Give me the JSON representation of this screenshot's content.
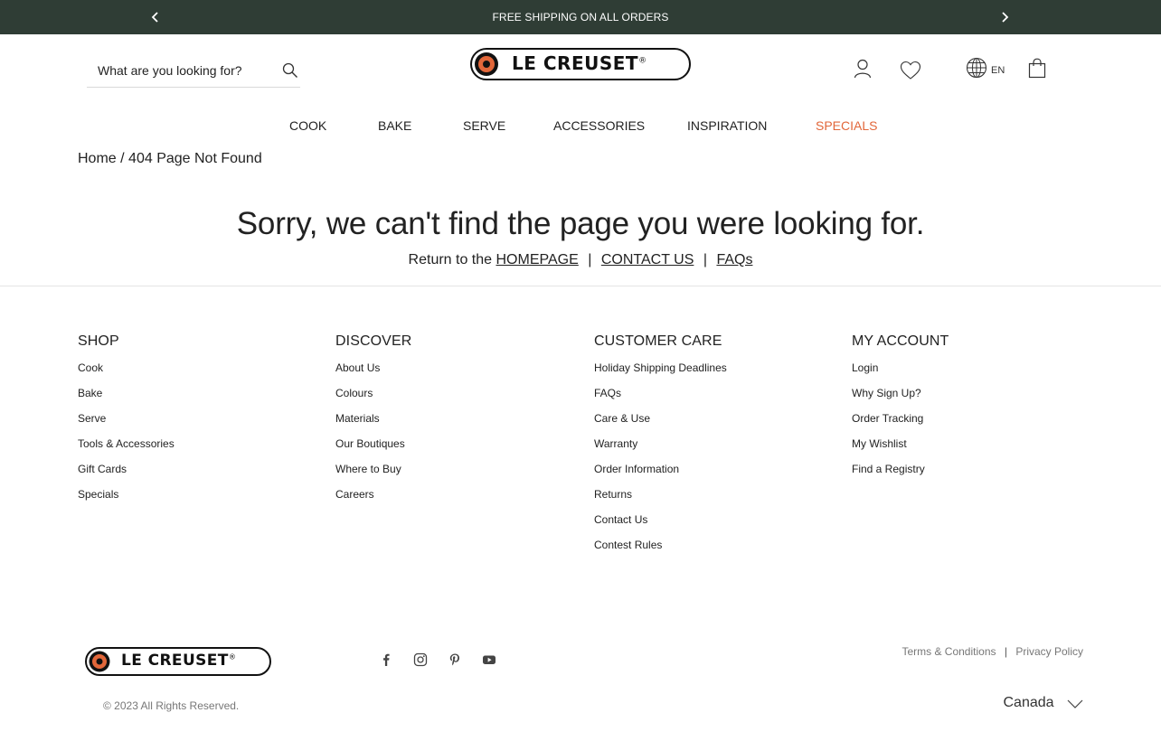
{
  "promo": {
    "text": "FREE SHIPPING ON ALL ORDERS",
    "prev_icon": "chevron-left-icon",
    "next_icon": "chevron-right-icon"
  },
  "header": {
    "search_placeholder": "What are you looking for?",
    "search_icon": "search-icon",
    "logo_text": "LE CREUSET",
    "logo_mark": "®",
    "account_icon": "user-icon",
    "wishlist_icon": "heart-icon",
    "language_icon": "globe-icon",
    "language": "EN",
    "cart_icon": "shopping-bag-icon"
  },
  "nav": {
    "items": [
      "COOK",
      "BAKE",
      "SERVE",
      "ACCESSORIES",
      "INSPIRATION",
      "SPECIALS"
    ],
    "specials_color": "#e2673a"
  },
  "breadcrumb": {
    "home": "Home",
    "separator": "/",
    "current": "404 Page Not Found"
  },
  "error": {
    "title": "Sorry, we can't find the page you were looking for.",
    "return_text": "Return to the",
    "homepage": "HOMEPAGE",
    "contact": "CONTACT US",
    "faqs": "FAQs",
    "separator": "|"
  },
  "footer": {
    "shop": {
      "title": "SHOP",
      "links": [
        "Cook",
        "Bake",
        "Serve",
        "Tools & Accessories",
        "Gift Cards",
        "Specials"
      ]
    },
    "discover": {
      "title": "DISCOVER",
      "links": [
        "About Us",
        "Colours",
        "Materials",
        "Our Boutiques",
        "Where to Buy",
        "Careers"
      ]
    },
    "customer_care": {
      "title": "CUSTOMER CARE",
      "links": [
        "Holiday Shipping Deadlines",
        "FAQs",
        "Care & Use",
        "Warranty",
        "Order Information",
        "Returns",
        "Contact Us",
        "Contest Rules"
      ]
    },
    "my_account": {
      "title": "MY ACCOUNT",
      "links": [
        "Login",
        "Why Sign Up?",
        "Order Tracking",
        "My Wishlist",
        "Find a Registry"
      ]
    },
    "social": [
      "facebook-icon",
      "instagram-icon",
      "pinterest-icon",
      "youtube-icon"
    ],
    "terms": "Terms & Conditions",
    "privacy": "Privacy Policy",
    "legal_separator": "|",
    "copyright": "© 2023 All Rights Reserved.",
    "region": "Canada",
    "region_icon": "chevron-down-icon"
  },
  "colors": {
    "promo_bg": "#2f3d35",
    "logo_orange": "#e2673a",
    "text": "#222222",
    "muted": "#777777"
  }
}
